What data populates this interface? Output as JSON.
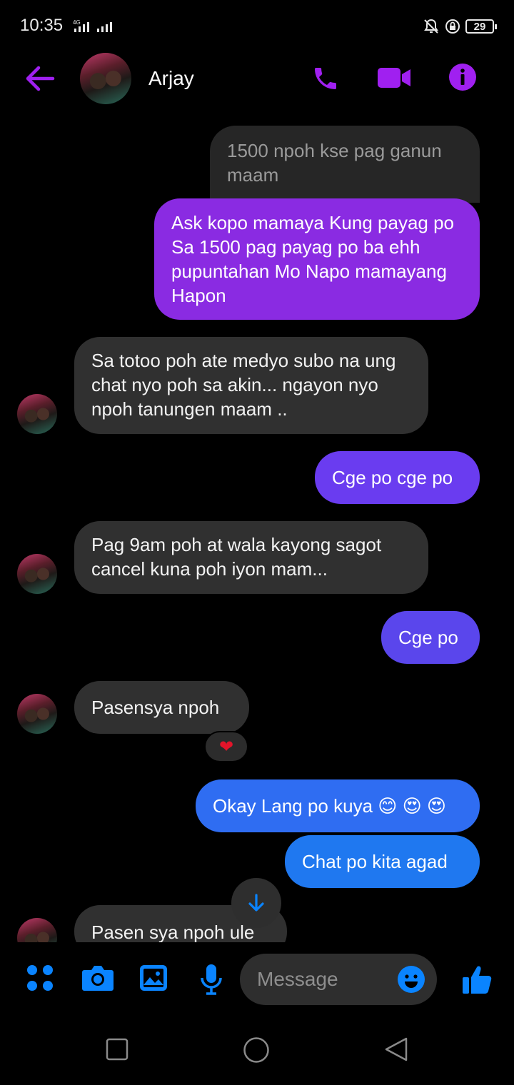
{
  "status_bar": {
    "time": "10:35",
    "network": "4G",
    "battery": "29"
  },
  "header": {
    "contact_name": "Arjay"
  },
  "messages": [
    {
      "direction": "outgoing",
      "text": "1500 npoh kse pag ganun maam",
      "style": "faded"
    },
    {
      "direction": "outgoing",
      "text": "Ask kopo mamaya Kung payag po Sa 1500 pag payag po ba ehh pupuntahan Mo Napo mamayang Hapon",
      "color": "#8a2be2"
    },
    {
      "direction": "incoming",
      "text": "Sa totoo poh ate medyo subo na ung chat nyo poh sa akin... ngayon nyo npoh tanungen maam .."
    },
    {
      "direction": "outgoing",
      "text": "Cge po cge po",
      "color": "#6a3cf0"
    },
    {
      "direction": "incoming",
      "text": "Pag 9am poh at wala kayong sagot cancel kuna poh iyon mam..."
    },
    {
      "direction": "outgoing",
      "text": "Cge po",
      "color": "#5a46ec"
    },
    {
      "direction": "incoming",
      "text": "Pasensya npoh",
      "reaction": "heart"
    },
    {
      "direction": "outgoing",
      "text": "Okay Lang po kuya 😊 😍 😍",
      "color": "#2f6df2"
    },
    {
      "direction": "outgoing",
      "text": "Chat po kita agad",
      "color": "#1f78f0"
    },
    {
      "direction": "incoming",
      "text": "Pasen sya npoh ule"
    }
  ],
  "reaction_glyph": "❤",
  "composer": {
    "placeholder": "Message"
  },
  "colors": {
    "accent_purple": "#a020f0",
    "accent_blue": "#0a84ff",
    "incoming_bubble": "#303030",
    "background": "#000000"
  }
}
